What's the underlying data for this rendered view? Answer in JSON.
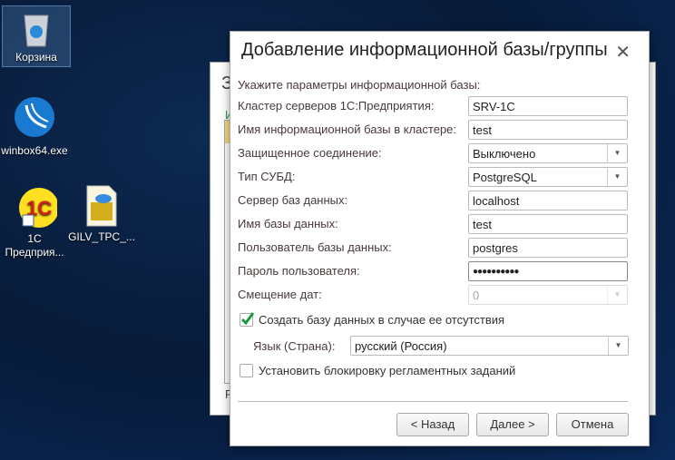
{
  "desktop": {
    "icons": [
      {
        "label": "Корзина"
      },
      {
        "label": "winbox64.exe"
      },
      {
        "label": "1С Предприя..."
      },
      {
        "label": "GILV_TPC_..."
      }
    ]
  },
  "background_window": {
    "title_fragment": "З",
    "tab_fragment": "И",
    "bottom_fragment": "Р"
  },
  "dialog": {
    "title": "Добавление информационной базы/группы",
    "prompt": "Укажите параметры информационной базы:",
    "fields": [
      {
        "label": "Кластер серверов 1С:Предприятия:",
        "value": "SRV-1C"
      },
      {
        "label": "Имя информационной базы в кластере:",
        "value": "test"
      },
      {
        "label": "Защищенное соединение:",
        "value": "Выключено"
      },
      {
        "label": "Тип СУБД:",
        "value": "PostgreSQL"
      },
      {
        "label": "Сервер баз данных:",
        "value": "localhost"
      },
      {
        "label": "Имя базы данных:",
        "value": "test"
      },
      {
        "label": "Пользователь базы данных:",
        "value": "postgres"
      },
      {
        "label": "Пароль пользователя:",
        "value": "●●●●●●●●●●"
      },
      {
        "label": "Смещение дат:",
        "value": "0"
      }
    ],
    "create_db": {
      "label": "Создать базу данных в случае ее отсутствия",
      "checked": true
    },
    "language": {
      "label": "Язык (Страна):",
      "value": "русский (Россия)"
    },
    "lock_jobs": {
      "label": "Установить блокировку регламентных заданий",
      "checked": false
    },
    "buttons": {
      "back": "< Назад",
      "next": "Далее >",
      "cancel": "Отмена"
    }
  }
}
